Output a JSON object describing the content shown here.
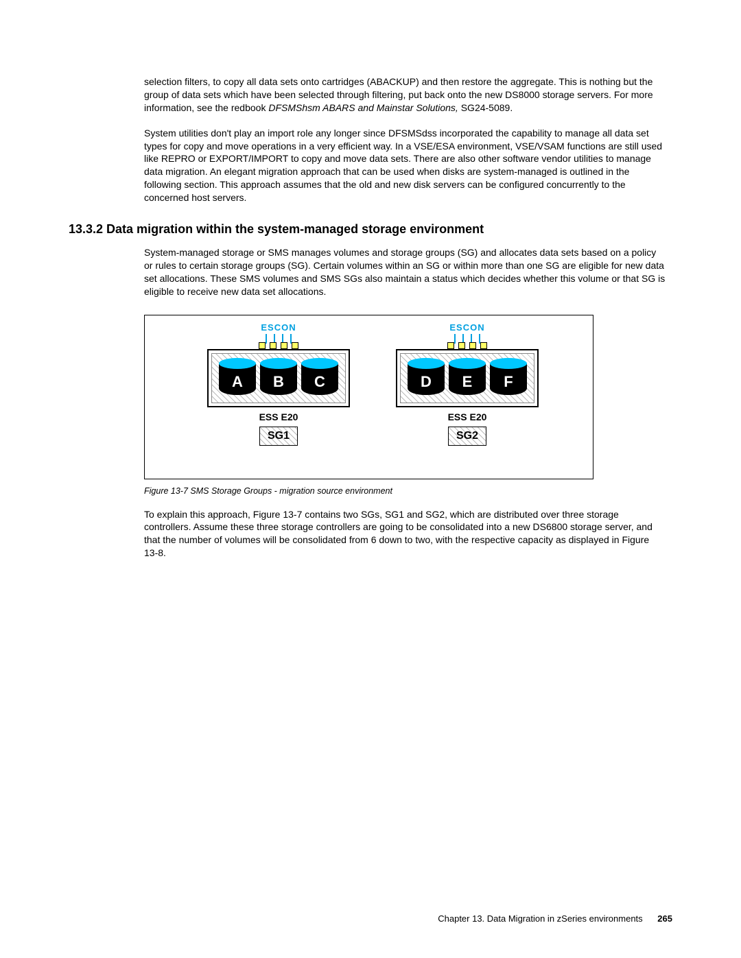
{
  "para1_a": "selection filters, to copy all data sets onto cartridges (ABACKUP) and then restore the aggregate. This is nothing but the group of data sets which have been selected through filtering, put back onto the new DS8000 storage servers. For more information, see the redbook ",
  "para1_b": "DFSMShsm ABARS and Mainstar Solutions, ",
  "para1_c": "SG24-5089.",
  "para2": "System utilities don't play an import role any longer since DFSMSdss incorporated the capability to manage all data set types for copy and move operations in a very efficient way. In a VSE/ESA environment, VSE/VSAM functions are still used like REPRO or EXPORT/IMPORT to copy and move data sets. There are also other software vendor utilities to manage data migration. An elegant migration approach that can be used when disks are system-managed is outlined in the following section. This approach assumes that the old and new disk servers can be configured concurrently to the concerned host servers.",
  "heading": "13.3.2  Data migration within the system-managed storage environment",
  "para3": "System-managed storage or SMS manages volumes and storage groups (SG) and allocates data sets based on a policy or rules to certain storage groups (SG). Certain volumes within an SG or within more than one SG are eligible for new data set allocations. These SMS volumes and SMS SGs also maintain a status which decides whether this volume or that SG is eligible to receive new data set allocations.",
  "figure": {
    "escon": "ESCON",
    "ess_caption": "ESS E20",
    "disks_left": [
      "A",
      "B",
      "C"
    ],
    "disks_right": [
      "D",
      "E",
      "F"
    ],
    "sg_left": "SG1",
    "sg_right": "SG2",
    "caption": "Figure 13-7   SMS Storage Groups - migration source environment"
  },
  "para4": "To explain this approach, Figure 13-7 contains two SGs, SG1 and SG2, which are distributed over three storage controllers. Assume these three storage controllers are going to be consolidated into a new DS6800 storage server, and that the number of volumes will be consolidated from 6 down to two, with the respective capacity as displayed in Figure 13-8.",
  "footer_chapter": "Chapter 13. Data Migration in zSeries environments",
  "footer_page": "265"
}
